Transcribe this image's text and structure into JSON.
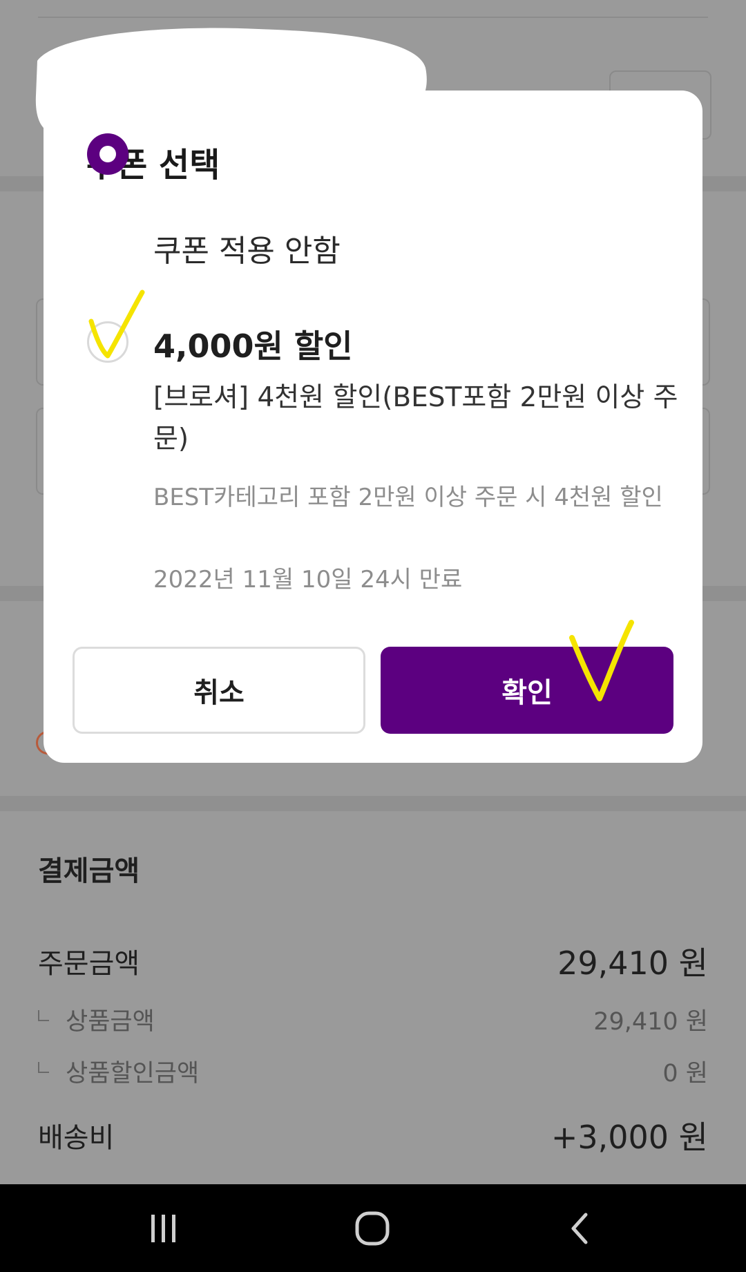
{
  "modal": {
    "title": "쿠폰 선택",
    "options": [
      {
        "label": "쿠폰 적용 안함",
        "selected": true
      },
      {
        "label": "4,000원 할인",
        "selected": false,
        "name": "[브로셔] 4천원 할인(BEST포함 2만원 이상 주문)",
        "description": "BEST카테고리 포함 2만원 이상 주문 시 4천원 할인",
        "expiry": "2022년 11월 10일 24시 만료"
      }
    ],
    "cancel_label": "취소",
    "confirm_label": "확인"
  },
  "payment": {
    "title": "결제금액",
    "order_amount_label": "주문금액",
    "order_amount_value": "29,410 원",
    "product_amount_label": "상품금액",
    "product_amount_value": "29,410 원",
    "product_discount_label": "상품할인금액",
    "product_discount_value": "0 원",
    "shipping_label": "배송비",
    "shipping_value": "+3,000 원"
  },
  "navbar": {
    "icons": [
      "recent-apps-icon",
      "home-icon",
      "back-icon"
    ]
  },
  "colors": {
    "accent": "#5c0080",
    "overlay": "#999999",
    "annotation": "#f5e400"
  }
}
